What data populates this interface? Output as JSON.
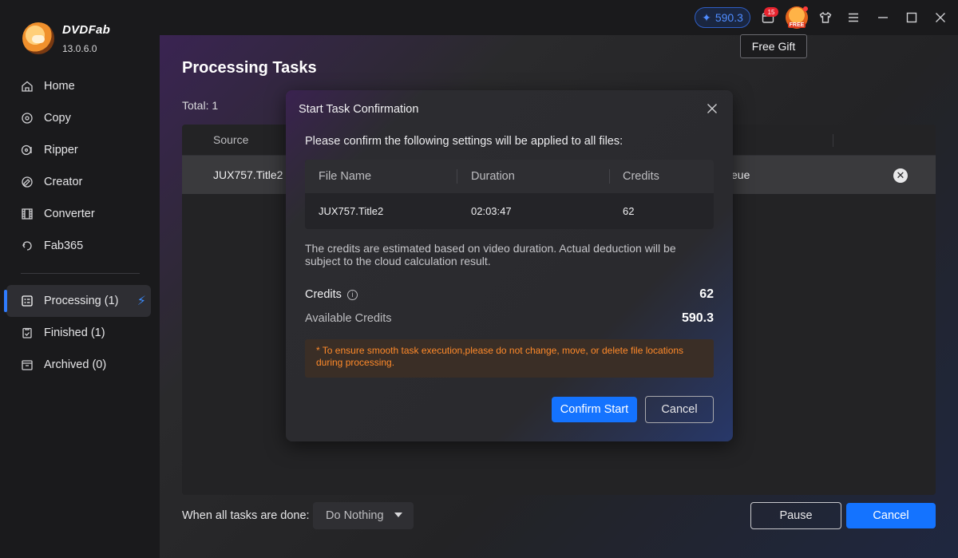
{
  "app": {
    "name": "DVDFab",
    "version": "13.0.6.0"
  },
  "sidebar": {
    "items": [
      {
        "label": "Home",
        "icon": "home-icon"
      },
      {
        "label": "Copy",
        "icon": "copy-icon"
      },
      {
        "label": "Ripper",
        "icon": "ripper-icon"
      },
      {
        "label": "Creator",
        "icon": "creator-icon"
      },
      {
        "label": "Converter",
        "icon": "converter-icon"
      },
      {
        "label": "Fab365",
        "icon": "fab365-icon"
      }
    ],
    "queue": [
      {
        "label": "Processing (1)",
        "icon": "processing-icon",
        "active": true
      },
      {
        "label": "Finished (1)",
        "icon": "finished-icon"
      },
      {
        "label": "Archived (0)",
        "icon": "archived-icon"
      }
    ]
  },
  "topbar": {
    "credits": "590.3",
    "notifications_badge": "15",
    "gift_label": "FREE",
    "tooltip": "Free Gift"
  },
  "main": {
    "title": "Processing Tasks",
    "total": "Total: 1",
    "table": {
      "header_source": "Source",
      "row": {
        "source": "JUX757.Title2",
        "status": "eue"
      }
    },
    "bottom": {
      "label": "When all tasks are done:",
      "dropdown_value": "Do Nothing",
      "pause": "Pause",
      "cancel": "Cancel"
    }
  },
  "modal": {
    "title": "Start Task Confirmation",
    "intro": "Please confirm the following settings will be applied to all files:",
    "table": {
      "headers": [
        "File Name",
        "Duration",
        "Credits"
      ],
      "row": [
        "JUX757.Title2",
        "02:03:47",
        "62"
      ]
    },
    "note": "The credits are estimated based on video duration. Actual deduction will be subject to the cloud calculation result.",
    "credits_label": "Credits",
    "credits_value": "62",
    "available_label": "Available Credits",
    "available_value": "590.3",
    "warning": "* To ensure smooth task execution,please do not change, move, or delete file locations during processing.",
    "confirm": "Confirm Start",
    "cancel": "Cancel"
  },
  "colors": {
    "accent": "#1473ff",
    "warning_text": "#ff8a2a",
    "badge": "#e8242f"
  }
}
